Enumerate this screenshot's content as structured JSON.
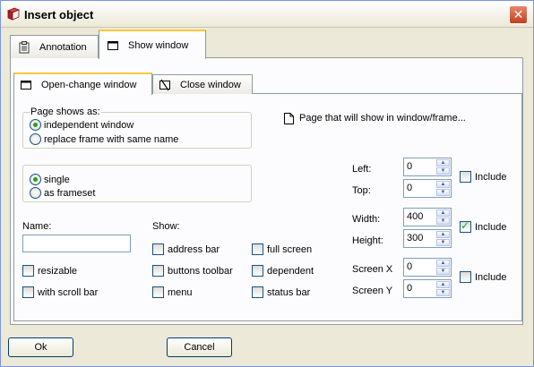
{
  "window": {
    "title": "Insert object",
    "close_glyph": "✕"
  },
  "outer_tabs": [
    {
      "label": "Annotation",
      "icon": "clipboard-icon"
    },
    {
      "label": "Show window",
      "icon": "window-icon"
    }
  ],
  "inner_tabs": [
    {
      "label": "Open-change window",
      "icon": "window-open-icon"
    },
    {
      "label": "Close window",
      "icon": "window-close-icon"
    }
  ],
  "page_shows": {
    "legend": "Page shows as:",
    "options": [
      {
        "label": "independent window",
        "checked": true
      },
      {
        "label": "replace frame with same name",
        "checked": false
      }
    ]
  },
  "page_target_text": "Page that will show in window/frame...",
  "frame_mode": {
    "options": [
      {
        "label": "single",
        "checked": true
      },
      {
        "label": "as frameset",
        "checked": false
      }
    ]
  },
  "name": {
    "label": "Name:",
    "value": ""
  },
  "show": {
    "label": "Show:",
    "col1": [
      {
        "label": "address bar",
        "checked": false
      },
      {
        "label": "buttons toolbar",
        "checked": false
      },
      {
        "label": "menu",
        "checked": false
      }
    ],
    "col2": [
      {
        "label": "full screen",
        "checked": false
      },
      {
        "label": "dependent",
        "checked": false
      },
      {
        "label": "status bar",
        "checked": false
      }
    ]
  },
  "misc": [
    {
      "label": "resizable",
      "checked": false
    },
    {
      "label": "with scroll bar",
      "checked": false
    }
  ],
  "position": {
    "left": {
      "label": "Left:",
      "value": "0"
    },
    "top": {
      "label": "Top:",
      "value": "0"
    },
    "include_label": "Include",
    "include_checked": false
  },
  "size": {
    "width": {
      "label": "Width:",
      "value": "400"
    },
    "height": {
      "label": "Height:",
      "value": "300"
    },
    "include_label": "Include",
    "include_checked": true
  },
  "screen": {
    "x": {
      "label": "Screen X",
      "value": "0"
    },
    "y": {
      "label": "Screen Y",
      "value": "0"
    },
    "include_label": "Include",
    "include_checked": false
  },
  "buttons": {
    "ok": "Ok",
    "cancel": "Cancel"
  },
  "spinner_glyphs": {
    "up": "▲",
    "down": "▼"
  }
}
